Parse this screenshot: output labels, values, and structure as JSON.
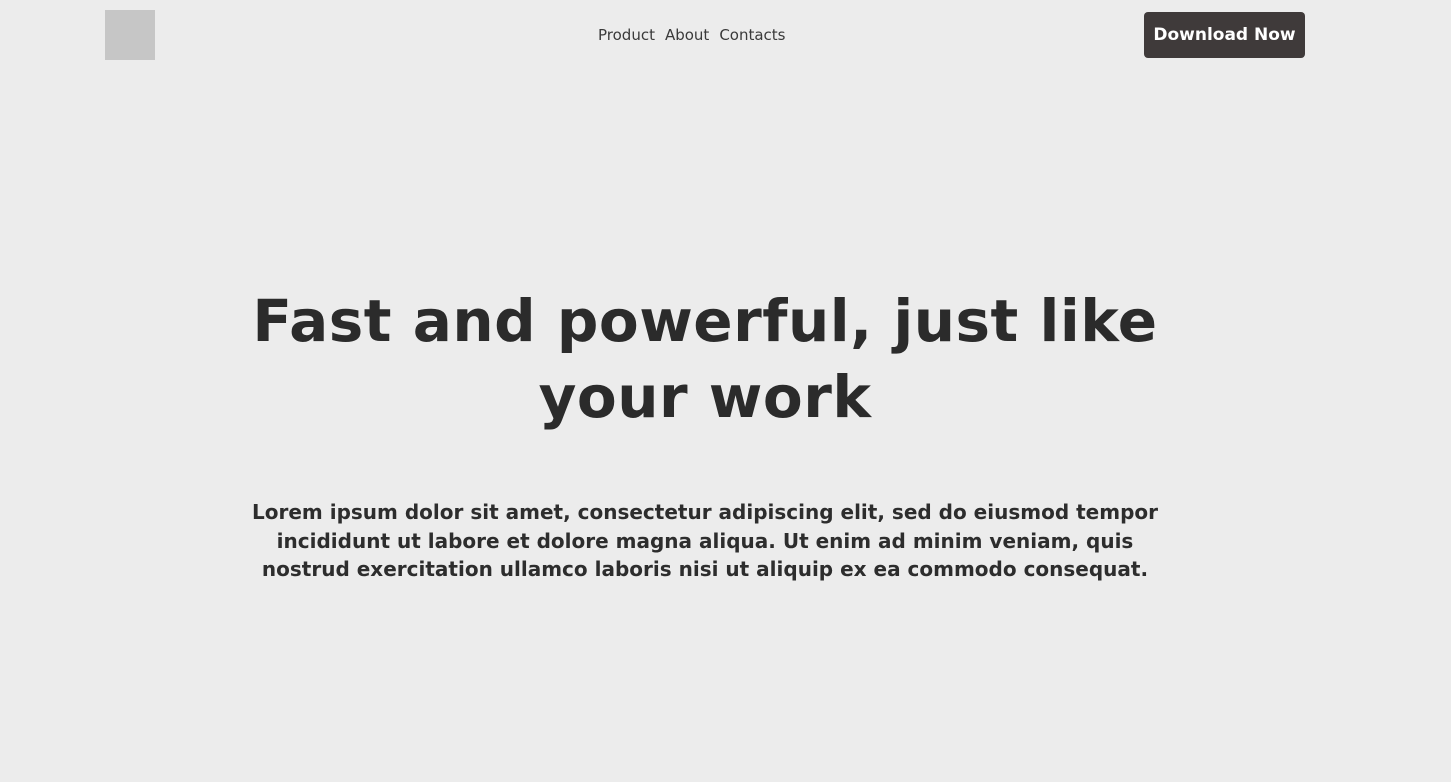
{
  "header": {
    "logo_alt": "",
    "nav": {
      "product": "Product",
      "about": "About",
      "contacts": "Contacts"
    },
    "cta_label": "Download Now"
  },
  "hero": {
    "title": "Fast and powerful, just like your work",
    "description": "Lorem ipsum dolor sit amet, consectetur adipiscing elit, sed do eiusmod tempor incididunt ut labore et dolore magna aliqua. Ut enim ad minim veniam, quis nostrud exercitation ullamco laboris nisi ut aliquip ex ea commodo consequat."
  },
  "colors": {
    "background": "#ececec",
    "logo_placeholder": "#c6c6c6",
    "button_bg": "#3f3a3a",
    "button_text": "#ffffff",
    "text": "#2d2d2d"
  }
}
